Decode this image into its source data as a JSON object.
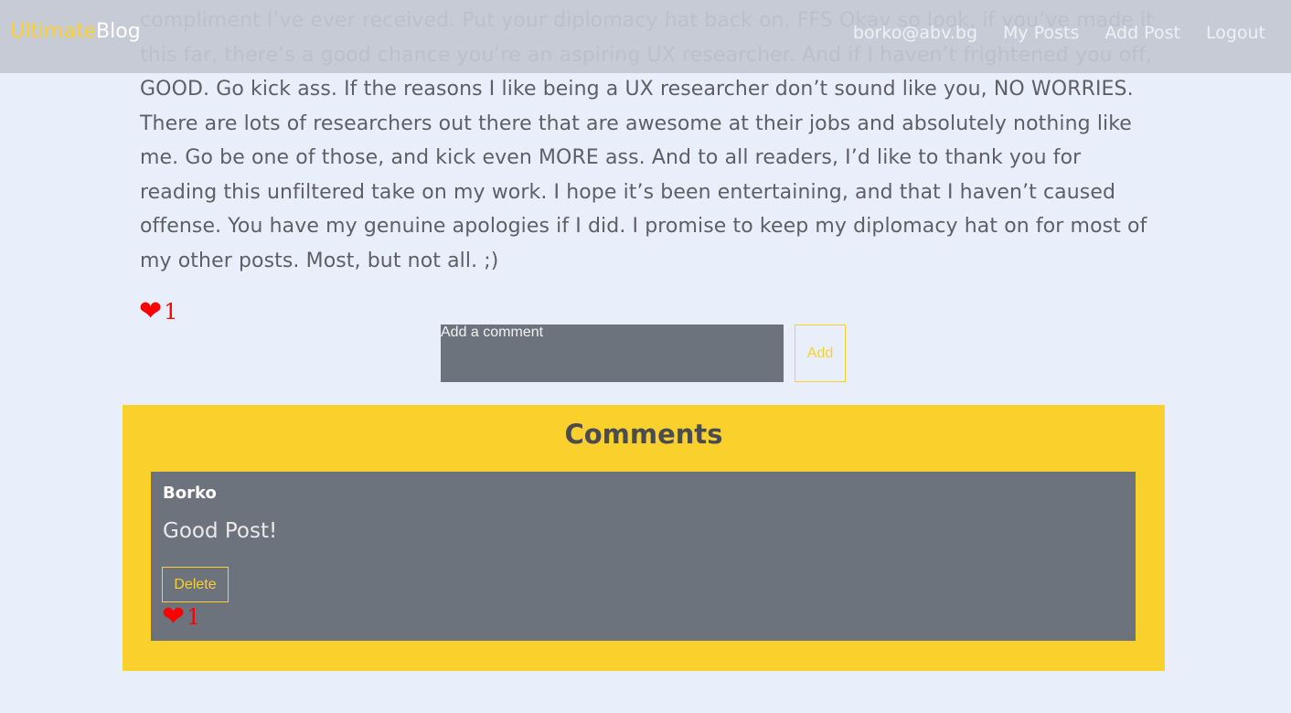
{
  "navbar": {
    "brand_part1": "Ultimate",
    "brand_part2": "Blog",
    "email": "borko@abv.bg",
    "my_posts": "My Posts",
    "add_post": "Add Post",
    "logout": "Logout"
  },
  "post": {
    "body": "compliment I’ve ever received. Put your diplomacy hat back on, FFS Okay so look, if you’ve made it this far, there’s a good chance you’re an aspiring UX researcher. And if I haven’t frightened you off, GOOD. Go kick ass. If the reasons I like being a UX researcher don’t sound like you, NO WORRIES. There are lots of researchers out there that are awesome at their jobs and absolutely nothing like me. Go be one of those, and kick even MORE ass. And to all readers, I’d like to thank you for reading this unfiltered take on my work. I hope it’s been entertaining, and that I haven’t caused offense. You have my genuine apologies if I did. I promise to keep my diplomacy hat on for most of my other posts. Most, but not all. ;)",
    "like_icon": "heart-icon",
    "likes": "1"
  },
  "comment_form": {
    "placeholder": "Add a comment",
    "add_label": "Add"
  },
  "comments": {
    "title": "Comments",
    "items": [
      {
        "author": "Borko",
        "text": "Good Post!",
        "delete_label": "Delete",
        "likes": "1"
      }
    ]
  },
  "colors": {
    "accent": "#f9d02c",
    "background": "#e9effa",
    "card": "#6c737d",
    "like": "#ff0000"
  }
}
